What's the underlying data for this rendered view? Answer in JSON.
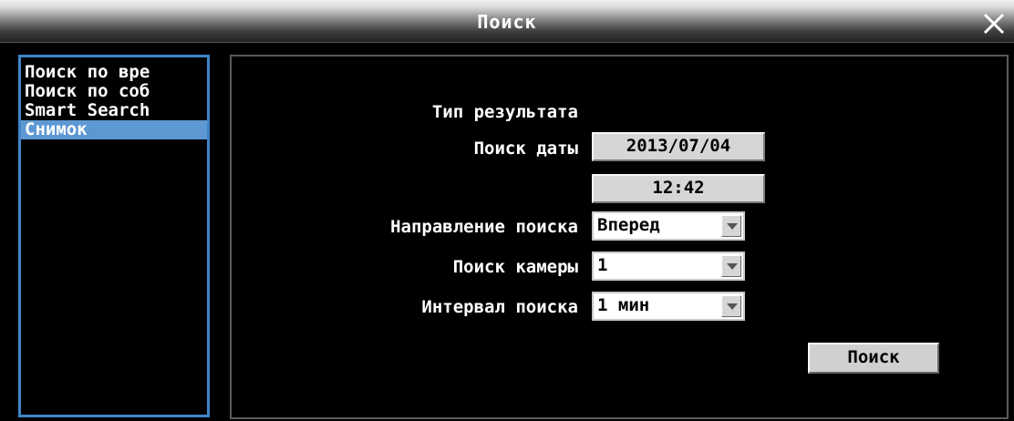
{
  "window": {
    "title": "Поиск",
    "close_icon": "close-icon"
  },
  "sidebar": {
    "items": [
      {
        "label": "Поиск по вре",
        "active": false
      },
      {
        "label": "Поиск по соб",
        "active": false
      },
      {
        "label": "Smart Search",
        "active": false
      },
      {
        "label": "Снимок",
        "active": true
      }
    ]
  },
  "form": {
    "result_type_label": "Тип результата",
    "date_label": "Поиск даты",
    "date_value": "2013/07/04",
    "time_value": "12:42",
    "direction_label": "Направление поиска",
    "direction_value": "Вперед",
    "camera_label": "Поиск камеры",
    "camera_value": "1",
    "interval_label": "Интервал поиска",
    "interval_value": "1 мин",
    "search_button": "Поиск"
  },
  "colors": {
    "selection": "#5e98d2",
    "panel_border": "#3f86c9"
  }
}
